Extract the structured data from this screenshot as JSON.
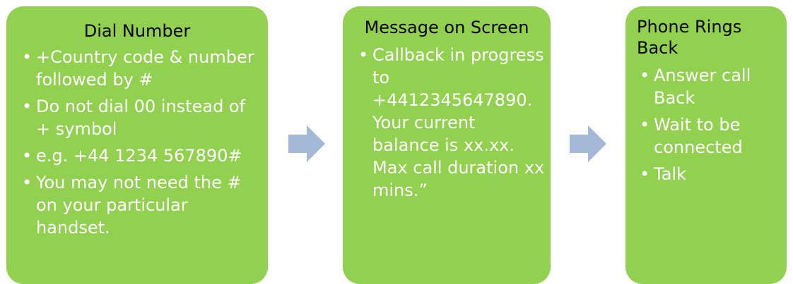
{
  "steps": [
    {
      "title": "Dial Number",
      "bullets": [
        "+Country code & number followed by #",
        "Do not dial 00 instead of + symbol",
        "e.g. +44 1234 567890#",
        "You may not need the # on your particular handset."
      ]
    },
    {
      "title": "Message on Screen",
      "bullets": [
        "Callback in progress to +4412345647890. Your current balance is xx.xx. Max call duration xx mins.”"
      ]
    },
    {
      "title": "Phone Rings Back",
      "bullets": [
        "Answer call Back",
        "Wait to be connected",
        "Talk"
      ]
    }
  ],
  "colors": {
    "box_fill": "#92d050",
    "title_text": "#000000",
    "bullet_text": "#ffffff",
    "arrow_fill": "#a5b8d8"
  },
  "icons": {
    "connector": "right-arrow-icon"
  }
}
